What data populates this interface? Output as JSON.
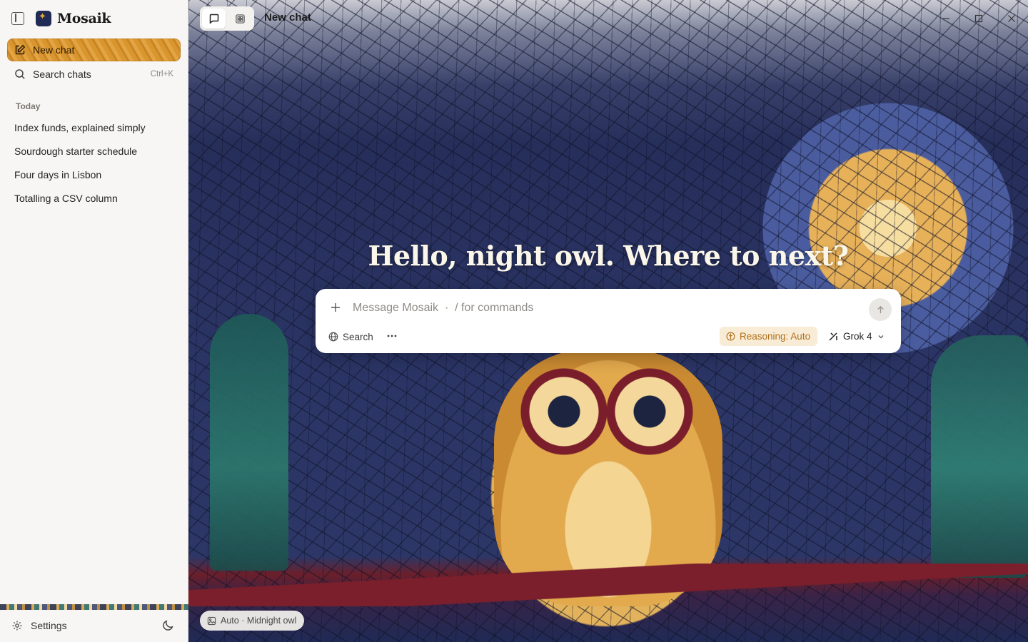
{
  "app": {
    "name": "Mosaik"
  },
  "sidebar": {
    "new_chat_label": "New chat",
    "search_label": "Search chats",
    "search_shortcut": "Ctrl+K",
    "section_label": "Today",
    "history": [
      {
        "label": "Index funds, explained simply"
      },
      {
        "label": "Sourdough starter schedule"
      },
      {
        "label": "Four days in Lisbon"
      },
      {
        "label": "Totalling a CSV column"
      }
    ],
    "settings_label": "Settings"
  },
  "header": {
    "title": "New chat"
  },
  "main": {
    "greeting": "Hello, night owl. Where to next?",
    "composer": {
      "placeholder": "Message Mosaik  ·  / for commands",
      "value": "",
      "search_label": "Search",
      "reasoning_label": "Reasoning: Auto",
      "model_label": "Grok 4"
    },
    "background_badge": "Auto · Midnight owl"
  },
  "icons": {
    "sidebar_toggle": "sidebar-toggle-icon",
    "new_chat": "compose-icon",
    "search": "search-icon",
    "settings": "gear-icon",
    "theme": "moon-icon",
    "chat_tab": "chat-bubble-icon",
    "gallery_tab": "grid-icon",
    "attach": "plus-icon",
    "send": "arrow-up-icon",
    "web_search": "globe-icon",
    "more": "ellipsis-icon",
    "reasoning": "brain-icon",
    "model": "grok-logo-icon",
    "badge": "image-icon"
  },
  "colors": {
    "accent": "#d99430",
    "reasoning_text": "#b06f1a",
    "reasoning_bg": "#f8ecd6",
    "headline": "#fbf6ea"
  }
}
